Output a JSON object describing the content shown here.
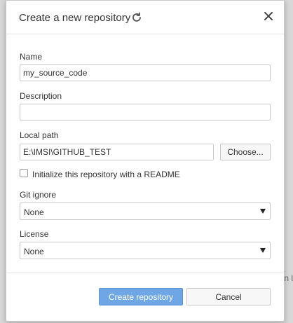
{
  "dialog": {
    "title": "Create a new repository"
  },
  "form": {
    "name_label": "Name",
    "name_value": "my_source_code",
    "description_label": "Description",
    "description_value": "",
    "local_path_label": "Local path",
    "local_path_value": "E:\\IMSI\\GITHUB_TEST",
    "choose_label": "Choose...",
    "readme_label": "Initialize this repository with a README",
    "readme_checked": false,
    "gitignore_label": "Git ignore",
    "gitignore_value": "None",
    "license_label": "License",
    "license_value": "None"
  },
  "footer": {
    "create_label": "Create repository",
    "cancel_label": "Cancel"
  },
  "background": {
    "fragment": "n l"
  },
  "colors": {
    "primary_button": "#6fa7e6",
    "text": "#333333",
    "border": "#c9c9c9"
  },
  "icons": [
    "refresh-icon",
    "close-icon",
    "dropdown-arrow-icon",
    "checkbox-icon"
  ]
}
